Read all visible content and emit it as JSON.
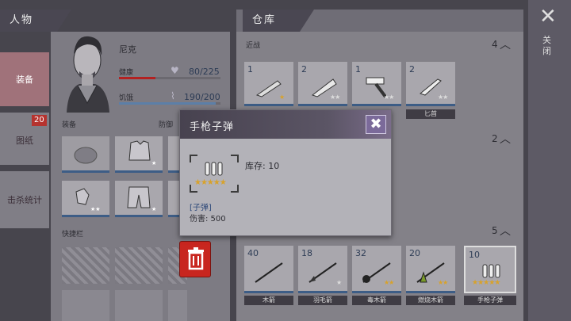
{
  "left_panel": {
    "title": "人物"
  },
  "nav": [
    {
      "label": "装备",
      "badge": ""
    },
    {
      "label": "图纸",
      "badge": "20"
    },
    {
      "label": "击杀统计",
      "badge": ""
    }
  ],
  "character": {
    "name": "尼克",
    "health_label": "健康",
    "health_value": "80/225",
    "health_fraction": 0.356,
    "hunger_label": "饥饿",
    "hunger_value": "190/200",
    "hunger_fraction": 0.95
  },
  "equip_label": "装备",
  "protection_label": "防御",
  "quickbar_label": "快捷栏",
  "warehouse": {
    "title": "仓库",
    "sections": [
      {
        "name": "近战",
        "count": "4",
        "items": [
          {
            "qty": "1",
            "name": "",
            "stars": "★",
            "icon": "machete-icon"
          },
          {
            "qty": "2",
            "name": "",
            "stars": "★★",
            "icon": "saw-blade-icon"
          },
          {
            "qty": "1",
            "name": "",
            "stars": "★★",
            "icon": "hammer-icon"
          },
          {
            "qty": "2",
            "name": "匕首",
            "stars": "★★",
            "icon": "knife-icon"
          }
        ]
      },
      {
        "name": "",
        "count": "2"
      },
      {
        "name": "",
        "count": "5",
        "items": [
          {
            "qty": "40",
            "name": "木箭",
            "stars": "",
            "icon": "wood-arrow-icon"
          },
          {
            "qty": "18",
            "name": "羽毛箭",
            "stars": "★",
            "icon": "feather-arrow-icon"
          },
          {
            "qty": "32",
            "name": "毒木箭",
            "stars": "★★",
            "icon": "poison-arrow-icon"
          },
          {
            "qty": "20",
            "name": "燃烧木箭",
            "stars": "★★",
            "icon": "fire-arrow-icon"
          },
          {
            "qty": "10",
            "name": "手枪子弹",
            "stars": "★★★★★",
            "icon": "pistol-bullets-icon"
          }
        ]
      }
    ]
  },
  "popup": {
    "title": "手枪子弹",
    "stock_label": "库存: 10",
    "stars": "★★★★★",
    "category": "[子弹]",
    "damage_label": "伤害: 500"
  },
  "close_label": "关闭"
}
